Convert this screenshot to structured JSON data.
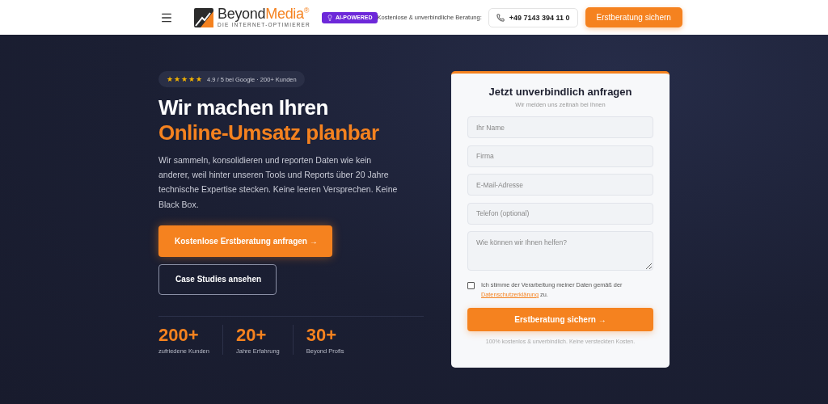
{
  "header": {
    "logo": {
      "word_1": "Beyond",
      "word_2": "Media",
      "mark": "®",
      "tagline": "DIE INTERNET-OPTIMIERER"
    },
    "badge": "AI-POWERED",
    "consult_label": "Kostenlose & unverbindliche Beratung:",
    "phone": "+49 7143 394 11 0",
    "cta": "Erstberatung sichern"
  },
  "hero": {
    "rating": {
      "stars": 5,
      "text": "4.9 / 5 bei Google · 200+ Kunden"
    },
    "title_1": "Wir machen Ihren",
    "title_2": "Online-Umsatz planbar",
    "text": "Wir sammeln, konsolidieren und reporten Daten wie kein anderer, weil hinter unseren Tools und Reports über 20 Jahre technische Expertise stecken. Keine leeren Versprechen. Keine Black Box.",
    "buttons": [
      {
        "kind": "primary",
        "label": "Kostenlose Erstberatung anfragen →"
      },
      {
        "kind": "outline",
        "label": "Case Studies ansehen"
      }
    ],
    "stats": [
      {
        "value": "200+",
        "label": "zufriedene Kunden"
      },
      {
        "value": "20+",
        "label": "Jahre Erfahrung"
      },
      {
        "value": "30+",
        "label": "Beyond Profis"
      }
    ]
  },
  "form": {
    "title": "Jetzt unverbindlich anfragen",
    "subtitle": "Wir melden uns zeitnah bei Ihnen",
    "fields": [
      {
        "kind": "input",
        "placeholder": "Ihr Name"
      },
      {
        "kind": "input",
        "placeholder": "Firma"
      },
      {
        "kind": "input",
        "placeholder": "E-Mail-Adresse"
      },
      {
        "kind": "input",
        "placeholder": "Telefon (optional)"
      },
      {
        "kind": "textarea",
        "placeholder": "Wie können wir Ihnen helfen?"
      }
    ],
    "consent": {
      "checked": false,
      "text_before": "Ich stimme der Verarbeitung meiner Daten gemäß der",
      "link": "Datenschutzerklärung",
      "text_after": "zu."
    },
    "submit": "Erstberatung sichern →",
    "note": "100% kostenlos & unverbindlich. Keine versteckten Kosten."
  }
}
